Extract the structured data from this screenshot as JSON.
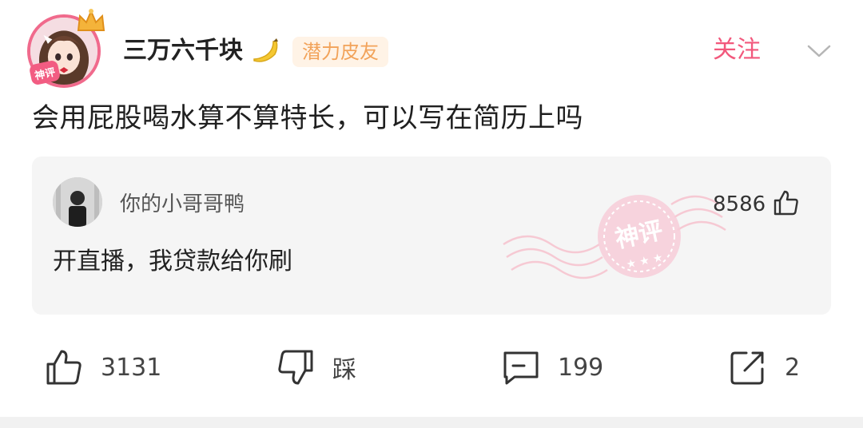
{
  "post": {
    "author": {
      "name": "三万六千块",
      "badge": "潜力皮友",
      "avatar_icon": "anime-girl-avatar",
      "crown_icon": "crown-icon",
      "badge_icon": "shenping-badge-icon"
    },
    "follow_label": "关注",
    "more_icon": "chevron-down-icon",
    "text": "会用屁股喝水算不算特长，可以写在简历上吗"
  },
  "top_comment": {
    "author": "你的小哥哥鸭",
    "likes": "8586",
    "text": "开直播，我贷款给你刷",
    "stamp_text": "神评"
  },
  "actions": {
    "like_count": "3131",
    "dislike_label": "踩",
    "comment_count": "199",
    "share_count": "2"
  },
  "colors": {
    "accent_pink": "#f2587c",
    "badge_text": "#f2a35a",
    "badge_bg": "#fff3e6",
    "comment_bg": "#f5f5f5"
  }
}
